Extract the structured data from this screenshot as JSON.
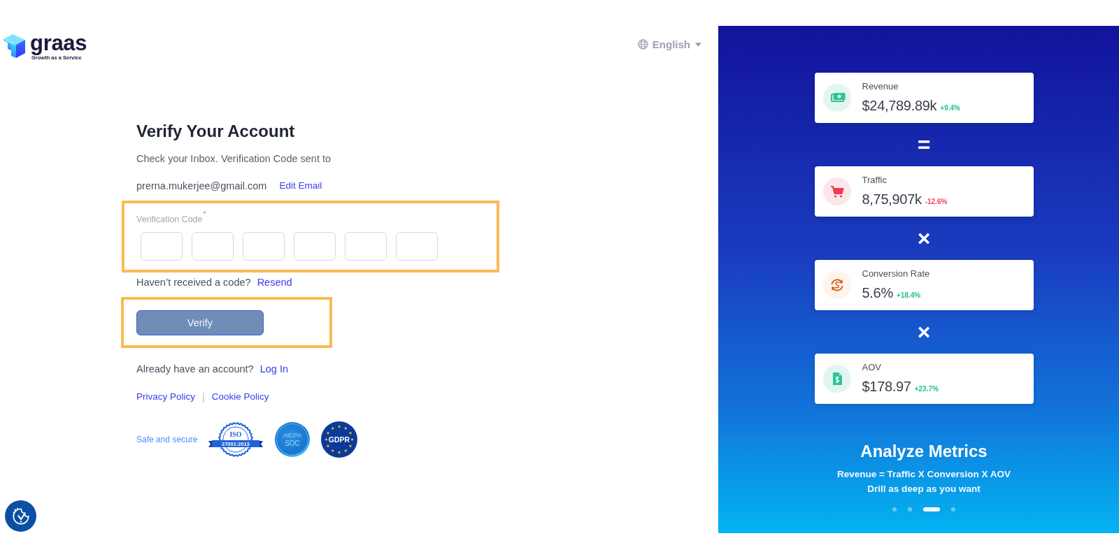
{
  "logo": {
    "name": "graas",
    "tagline": "Growth as a Service"
  },
  "language": {
    "label": "English"
  },
  "form": {
    "title": "Verify Your Account",
    "instruction": "Check your Inbox. Verification Code sent to",
    "email": "prerna.mukerjee@gmail.com",
    "edit_email": "Edit Email",
    "code_field": {
      "label": "Verification Code",
      "required_mark": "*",
      "highlighted": true,
      "boxes": [
        {
          "kind": "digit"
        },
        {
          "kind": "digit"
        },
        {
          "kind": "digit"
        },
        {
          "kind": "digit"
        },
        {
          "kind": "digit"
        },
        {
          "kind": "digit"
        }
      ]
    },
    "resend": {
      "prompt": "Haven’t received a code?",
      "link": "Resend"
    },
    "verify_button": {
      "label": "Verify",
      "disabled": true,
      "highlighted": true
    },
    "login": {
      "prompt": "Already have an account?",
      "link": "Log In"
    },
    "policies": {
      "links": [
        "Privacy Policy",
        "Cookie Policy"
      ],
      "separator": "|"
    },
    "security": {
      "label": "Safe and secure",
      "seals": [
        {
          "kind": "iso",
          "title": "ISO",
          "number": "27001:2013"
        },
        {
          "kind": "aicpa",
          "title": "AICPA",
          "subtitle": "SOC"
        },
        {
          "kind": "gdpr",
          "title": "GDPR"
        }
      ]
    }
  },
  "promo": {
    "metrics": [
      {
        "kind": "money",
        "label": "Revenue",
        "value": "$24,789.89k",
        "change": "+9.4%",
        "color": "#22bf8e"
      },
      {
        "kind": "cart",
        "operator": "=",
        "label": "Traffic",
        "value": "8,75,907k",
        "change": "-12.6%",
        "color": "#f0455b"
      },
      {
        "kind": "conversion",
        "operator": "×",
        "label": "Conversion Rate",
        "value": "5.6%",
        "change": "+18.4%",
        "color": "#22bf8e"
      },
      {
        "kind": "invoice",
        "operator": "×",
        "label": "AOV",
        "value": "$178.97",
        "change": "+23.7%",
        "color": "#22bf8e"
      }
    ],
    "headline": "Analyze Metrics",
    "lines": [
      "Revenue = Traffic X Conversion X AOV",
      "Drill as deep as you want"
    ],
    "slides": [
      {
        "selected": false
      },
      {
        "selected": false
      },
      {
        "selected": true
      },
      {
        "selected": false
      }
    ]
  }
}
